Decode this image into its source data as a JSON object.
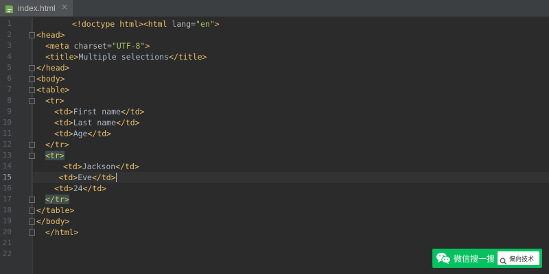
{
  "tab": {
    "label": "index.html",
    "icon": "html-file-icon"
  },
  "colors": {
    "background": "#2b2b2b",
    "gutter": "#313335",
    "tag": "#e8bf6a",
    "attribute": "#bababa",
    "string": "#a5c261",
    "text": "#a9b7c6",
    "highlight": "#3b514d",
    "watermark": "#07c160"
  },
  "editor": {
    "current_line": 15,
    "lines": [
      {
        "num": "1",
        "indent": 4,
        "tokens": [
          [
            "tag",
            "<!doctype html"
          ],
          [
            "tag",
            ">"
          ],
          [
            "tag",
            "<html "
          ],
          [
            "attr",
            "lang="
          ],
          [
            "val",
            "\"en\""
          ],
          [
            "tag",
            ">"
          ]
        ]
      },
      {
        "num": "2",
        "indent": 0,
        "tokens": [
          [
            "tag",
            "<head>"
          ]
        ]
      },
      {
        "num": "3",
        "indent": 1,
        "tokens": [
          [
            "tag",
            "<meta "
          ],
          [
            "attr",
            "charset="
          ],
          [
            "val",
            "\"UTF-8\""
          ],
          [
            "tag",
            ">"
          ]
        ]
      },
      {
        "num": "4",
        "indent": 1,
        "tokens": [
          [
            "tag",
            "<title>"
          ],
          [
            "txt",
            "Multiple selections"
          ],
          [
            "tag",
            "</title>"
          ]
        ]
      },
      {
        "num": "5",
        "indent": 0,
        "tokens": [
          [
            "tag",
            "</head>"
          ]
        ]
      },
      {
        "num": "6",
        "indent": 0,
        "tokens": [
          [
            "tag",
            "<body>"
          ]
        ]
      },
      {
        "num": "7",
        "indent": 0,
        "tokens": [
          [
            "tag",
            "<table>"
          ]
        ]
      },
      {
        "num": "8",
        "indent": 1,
        "tokens": [
          [
            "tag",
            "<tr>"
          ]
        ]
      },
      {
        "num": "9",
        "indent": 2,
        "tokens": [
          [
            "tag",
            "<td>"
          ],
          [
            "txt",
            "First name"
          ],
          [
            "tag",
            "</td>"
          ]
        ]
      },
      {
        "num": "10",
        "indent": 2,
        "tokens": [
          [
            "tag",
            "<td>"
          ],
          [
            "txt",
            "Last name"
          ],
          [
            "tag",
            "</td>"
          ]
        ]
      },
      {
        "num": "11",
        "indent": 2,
        "tokens": [
          [
            "tag",
            "<td>"
          ],
          [
            "txt",
            "Age"
          ],
          [
            "tag",
            "</td>"
          ]
        ]
      },
      {
        "num": "12",
        "indent": 1,
        "tokens": [
          [
            "tag",
            "</tr>"
          ]
        ]
      },
      {
        "num": "13",
        "indent": 1,
        "tokens": [
          [
            "hl",
            "<tr>"
          ]
        ]
      },
      {
        "num": "14",
        "indent": 3,
        "tokens": [
          [
            "tag",
            "<td>"
          ],
          [
            "txt",
            "Jackson"
          ],
          [
            "tag",
            "</td>"
          ]
        ]
      },
      {
        "num": "15",
        "indent": 2.5,
        "tokens": [
          [
            "tag",
            "<td>"
          ],
          [
            "txt",
            "Eve"
          ],
          [
            "tag",
            "</td>"
          ],
          [
            "caret",
            ""
          ]
        ]
      },
      {
        "num": "16",
        "indent": 2,
        "tokens": [
          [
            "tag",
            "<td>"
          ],
          [
            "txt",
            "24"
          ],
          [
            "tag",
            "</td>"
          ]
        ]
      },
      {
        "num": "17",
        "indent": 1,
        "tokens": [
          [
            "hl",
            "</tr>"
          ]
        ]
      },
      {
        "num": "18",
        "indent": 0,
        "tokens": [
          [
            "tag",
            "</table>"
          ]
        ]
      },
      {
        "num": "19",
        "indent": 0,
        "tokens": [
          [
            "tag",
            "</body>"
          ]
        ]
      },
      {
        "num": "20",
        "indent": 1,
        "tokens": [
          [
            "tag",
            "</html>"
          ]
        ]
      },
      {
        "num": "21",
        "indent": 0,
        "tokens": []
      },
      {
        "num": "22",
        "indent": 0,
        "tokens": []
      }
    ]
  },
  "watermark": {
    "logo": "wechat-logo-icon",
    "text": "微信搜一搜",
    "search_icon": "search-icon",
    "search_text": "偏向技术"
  }
}
